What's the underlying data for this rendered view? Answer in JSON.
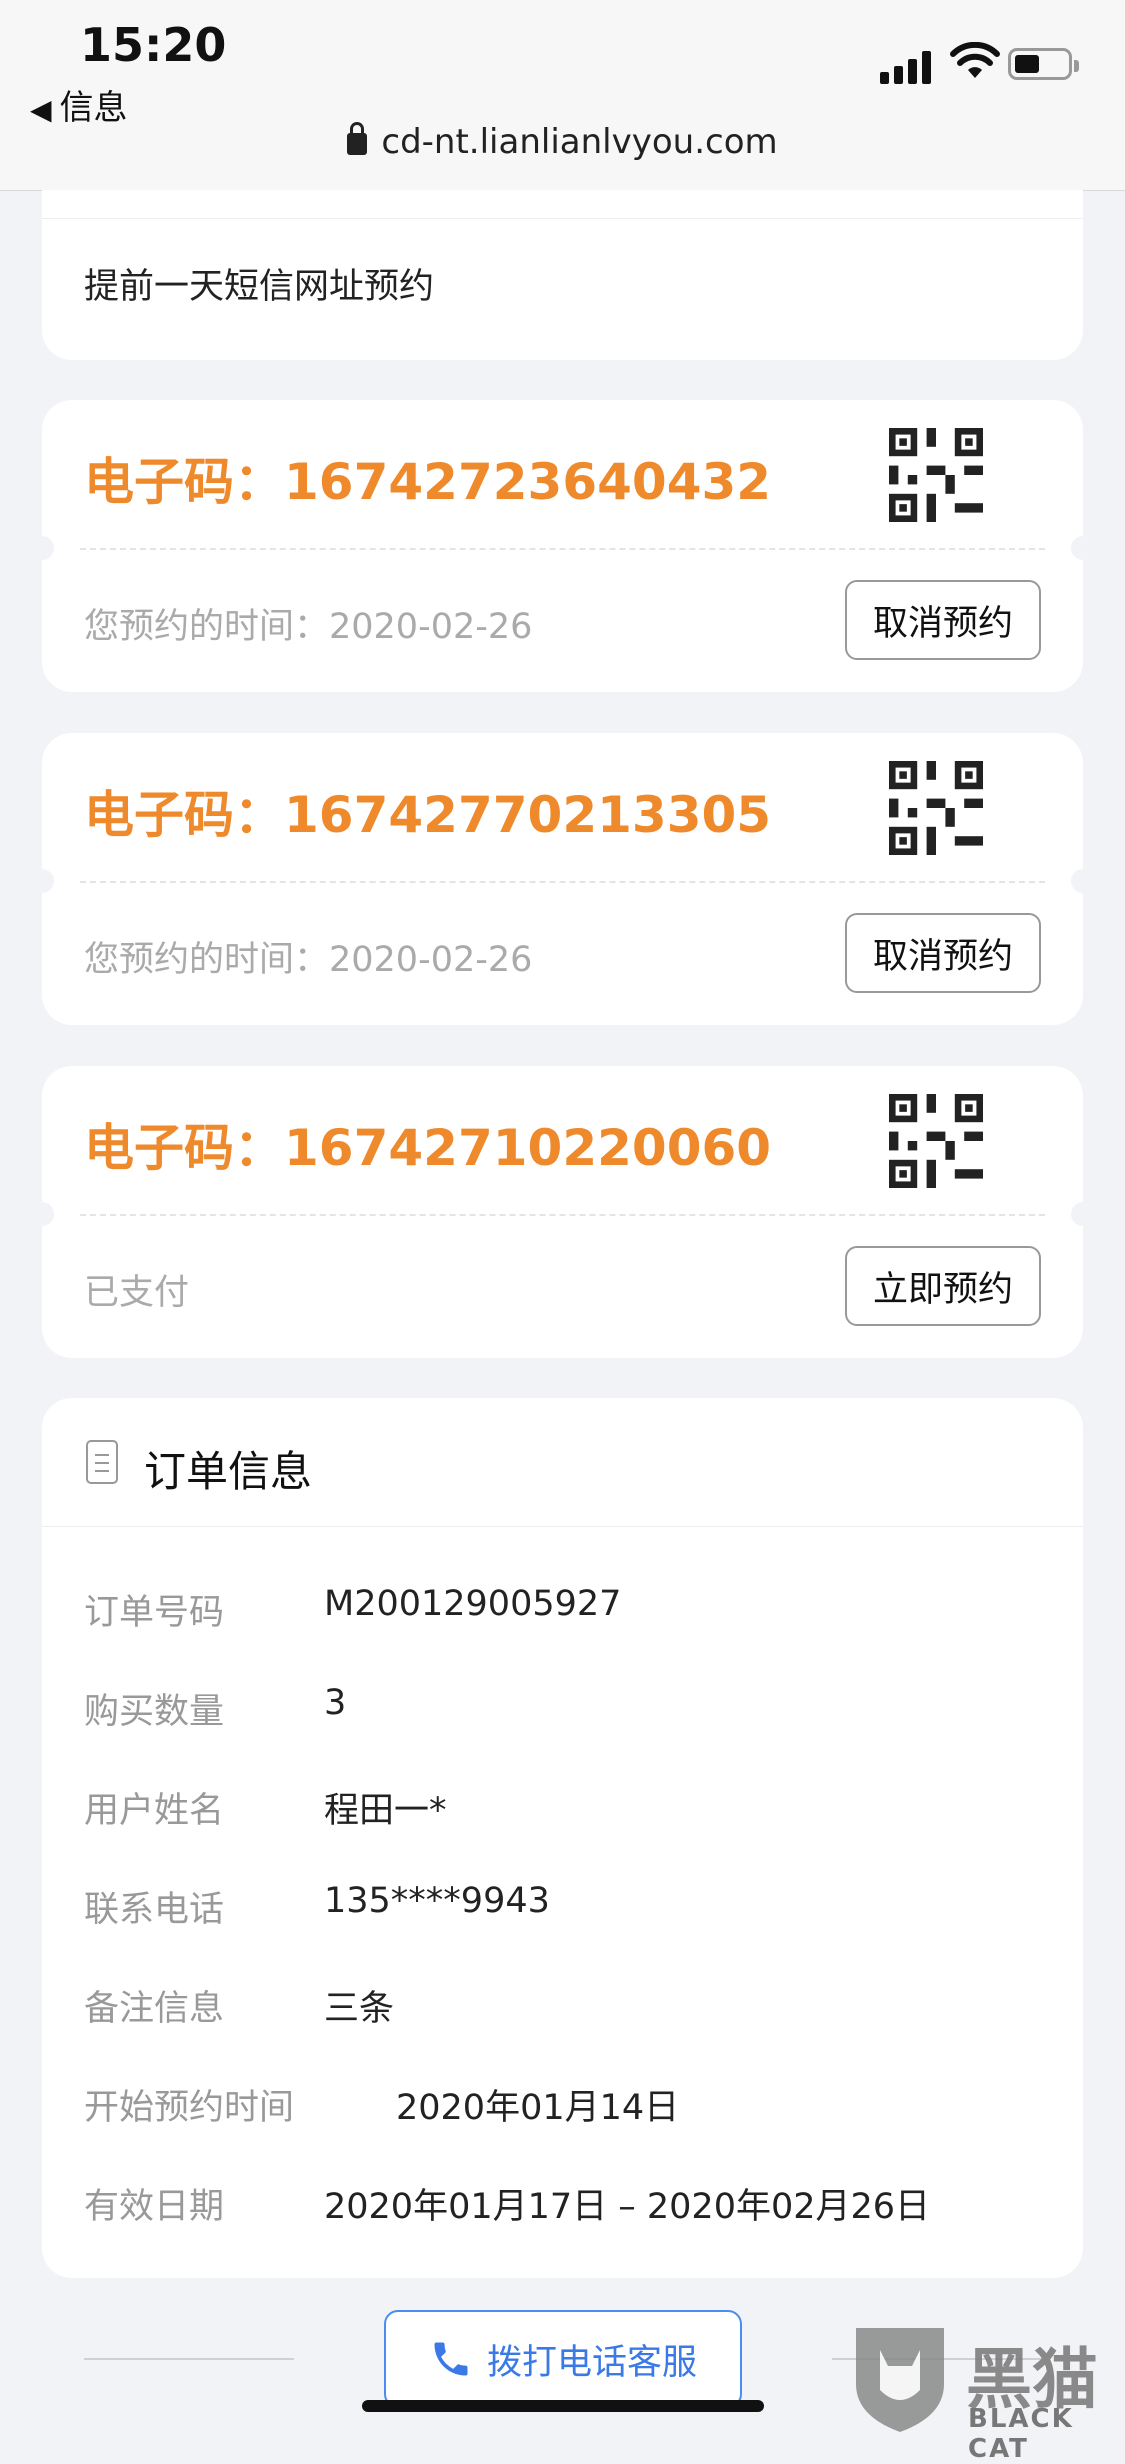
{
  "status": {
    "time": "15:20",
    "back_label": "信息"
  },
  "browser": {
    "url": "cd-nt.lianlianlvyou.com"
  },
  "booking_note": "提前一天短信网址预约",
  "codes": [
    {
      "label": "电子码：16742723640432",
      "status": "您预约的时间：2020-02-26",
      "action": "取消预约"
    },
    {
      "label": "电子码：16742770213305",
      "status": "您预约的时间：2020-02-26",
      "action": "取消预约"
    },
    {
      "label": "电子码：16742710220060",
      "status": "已支付",
      "action": "立即预约"
    }
  ],
  "order": {
    "title": "订单信息",
    "rows": [
      {
        "key": "订单号码",
        "value": "M200129005927"
      },
      {
        "key": "购买数量",
        "value": "3"
      },
      {
        "key": "用户姓名",
        "value": "程田一*"
      },
      {
        "key": "联系电话",
        "value": "135****9943"
      },
      {
        "key": "备注信息",
        "value": "三条"
      },
      {
        "key": "开始预约时间",
        "value": "2020年01月14日"
      },
      {
        "key": "有效日期",
        "value": "2020年01月17日 – 2020年02月26日"
      }
    ]
  },
  "footer": {
    "call_label": "拨打电话客服"
  },
  "watermark": {
    "text": "黑猫",
    "sub": "BLACK CAT"
  },
  "colors": {
    "accent": "#ef8a2c",
    "link": "#3b7ae6"
  }
}
